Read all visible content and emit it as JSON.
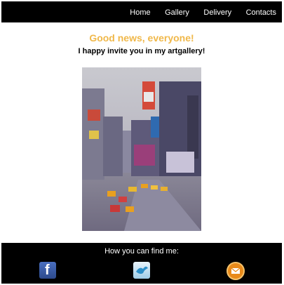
{
  "nav": {
    "items": [
      "Home",
      "Gallery",
      "Delivery",
      "Contacts"
    ]
  },
  "main": {
    "headline": "Good news, everyone!",
    "subline": "I happy invite you in my artgallery!"
  },
  "footer": {
    "find_label": "How you can find me:",
    "icons": [
      "facebook-icon",
      "bird-icon",
      "mail-icon"
    ]
  },
  "colors": {
    "topbar": "#000000",
    "headline": "#f0b84a",
    "footer": "#000000"
  }
}
